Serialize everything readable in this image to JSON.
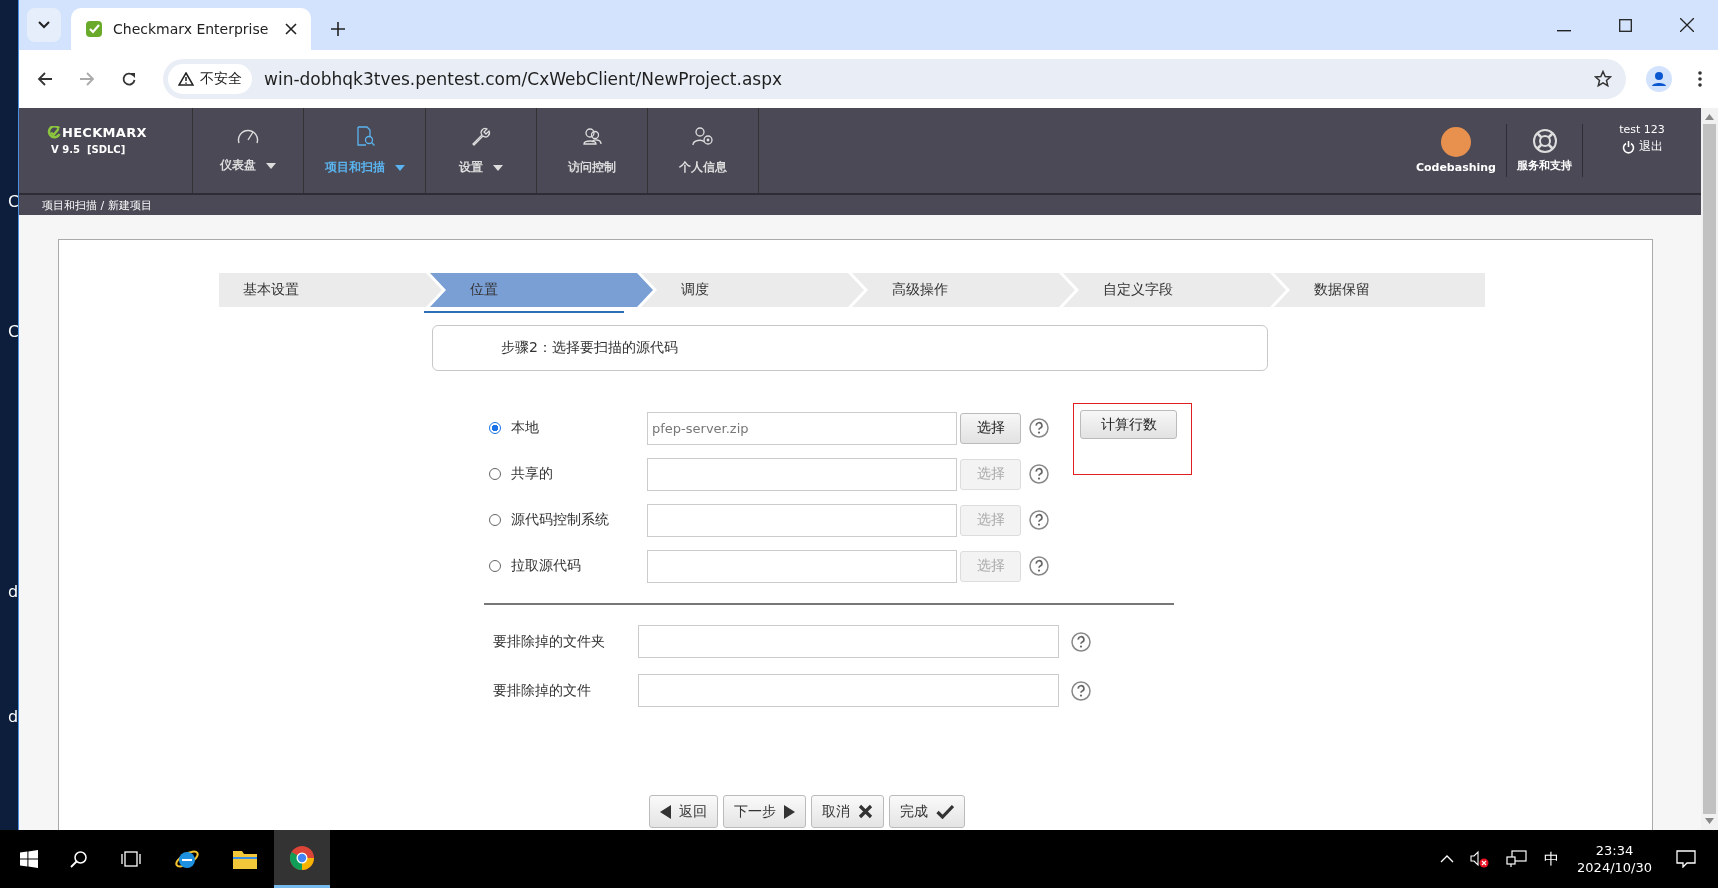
{
  "desktop": {
    "icon_labels": [
      "C",
      "C",
      "d",
      "d"
    ]
  },
  "browser": {
    "tabs": [
      {
        "title": "Checkmarx Enterprise",
        "selected": true
      }
    ],
    "security_label": "不安全",
    "url": "win-dobhqk3tves.pentest.com/CxWebClient/NewProject.aspx"
  },
  "app_header": {
    "logo": "HECKMARX",
    "version": "V 9.5  [SDLC]",
    "nav": [
      {
        "label": "仪表盘",
        "selected": false,
        "dropdown": true
      },
      {
        "label": "项目和扫描",
        "selected": true,
        "dropdown": true
      },
      {
        "label": "设置",
        "selected": false,
        "dropdown": true
      },
      {
        "label": "访问控制",
        "selected": false,
        "dropdown": false
      },
      {
        "label": "个人信息",
        "selected": false,
        "dropdown": false
      }
    ],
    "codebashing": "Codebashing",
    "support": "服务和支持",
    "user": "test 123",
    "logout": "退出"
  },
  "breadcrumb": "项目和扫描 / 新建项目",
  "wizard_steps": [
    {
      "label": "基本设置",
      "selected": false
    },
    {
      "label": "位置",
      "selected": true
    },
    {
      "label": "调度",
      "selected": false
    },
    {
      "label": "高级操作",
      "selected": false
    },
    {
      "label": "自定义字段",
      "selected": false
    },
    {
      "label": "数据保留",
      "selected": false
    }
  ],
  "step_title": "步骤2：选择要扫描的源代码",
  "sources": [
    {
      "label": "本地",
      "selected": true,
      "value": "pfep-server.zip",
      "button": "选择",
      "disabled": false
    },
    {
      "label": "共享的",
      "selected": false,
      "button": "选择",
      "disabled": true
    },
    {
      "label": "源代码控制系统",
      "selected": false,
      "button": "选择",
      "disabled": true
    },
    {
      "label": "拉取源代码",
      "selected": false,
      "button": "选择",
      "disabled": true
    }
  ],
  "count_button": {
    "label": "计算行数",
    "highlighted": true
  },
  "excludes": [
    {
      "label": "要排除掉的文件夹"
    },
    {
      "label": "要排除掉的文件"
    }
  ],
  "footer_buttons": [
    {
      "label": "返回",
      "kind": "back"
    },
    {
      "label": "下一步",
      "kind": "next"
    },
    {
      "label": "取消",
      "kind": "cancel"
    },
    {
      "label": "完成",
      "kind": "finish"
    }
  ],
  "taskbar": {
    "ime": "中",
    "time": "23:34",
    "date": "2024/10/30"
  }
}
